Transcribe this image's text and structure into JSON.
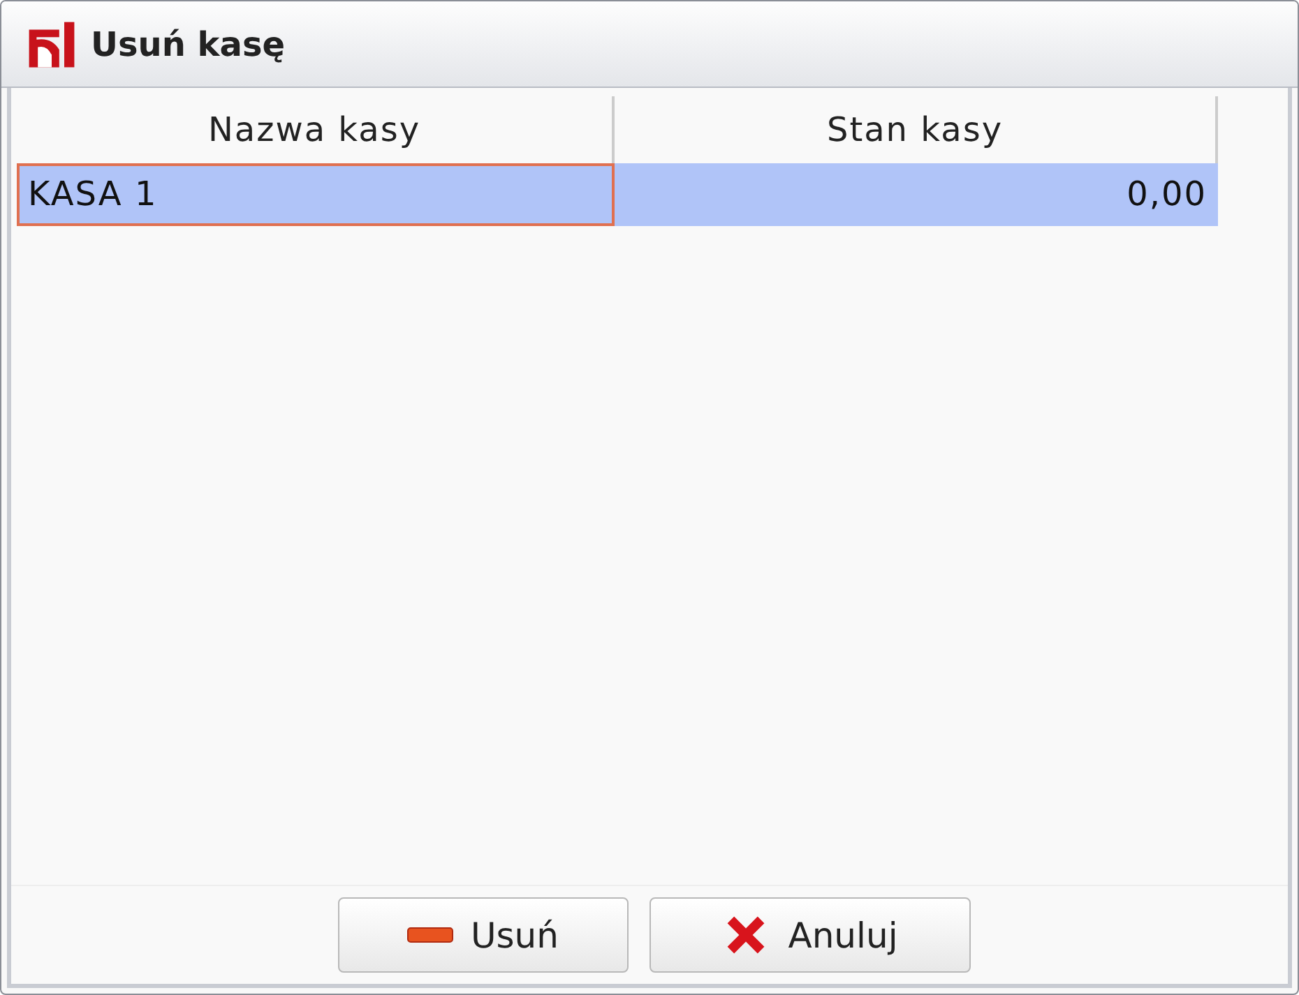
{
  "window": {
    "title": "Usuń kasę"
  },
  "table": {
    "columns": [
      "Nazwa kasy",
      "Stan kasy"
    ],
    "rows": [
      {
        "cells": [
          "KASA 1",
          "0,00"
        ],
        "selected": true
      }
    ]
  },
  "buttons": [
    {
      "label": "Usuń",
      "kind": "remove"
    },
    {
      "label": "Anuluj",
      "kind": "cancel"
    }
  ]
}
